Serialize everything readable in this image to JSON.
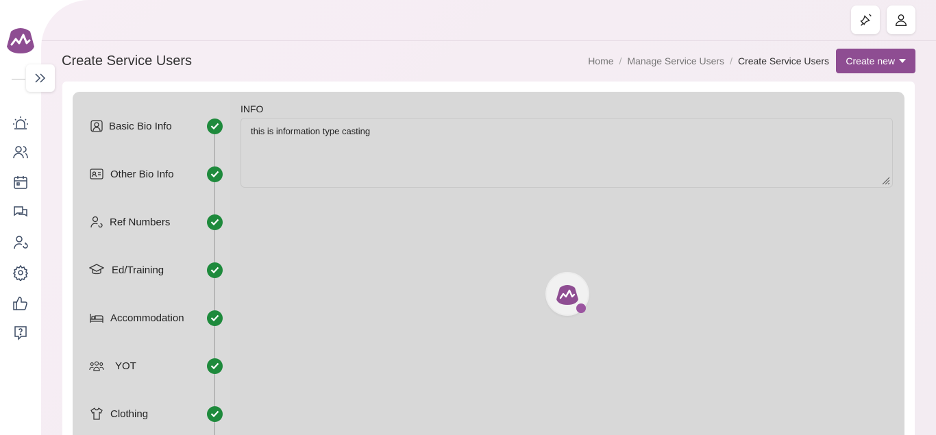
{
  "header": {
    "page_title": "Create Service Users",
    "breadcrumb": [
      "Home",
      "Manage Service Users",
      "Create Service Users"
    ],
    "create_button": "Create new",
    "top_icons": [
      "notification-icon",
      "user-icon"
    ]
  },
  "rail": {
    "icons": [
      "alarm-icon",
      "people-icon",
      "calendar-icon",
      "chat-icon",
      "user-refresh-icon",
      "gear-icon",
      "thumbs-up-icon",
      "help-icon"
    ]
  },
  "steps": [
    {
      "label": "Basic Bio Info",
      "icon": "user-square-icon",
      "done": true
    },
    {
      "label": "Other Bio Info",
      "icon": "id-card-icon",
      "done": true
    },
    {
      "label": "Ref Numbers",
      "icon": "user-ref-icon",
      "done": true
    },
    {
      "label": "Ed/Training",
      "icon": "graduation-cap-icon",
      "done": true
    },
    {
      "label": "Accommodation",
      "icon": "bed-icon",
      "done": true
    },
    {
      "label": "YOT",
      "icon": "group-icon",
      "done": true
    },
    {
      "label": "Clothing",
      "icon": "shirt-icon",
      "done": true
    }
  ],
  "info": {
    "label": "INFO",
    "value": "this is information type casting"
  },
  "colors": {
    "accent": "#8e4d92",
    "check": "#1e8a3c"
  }
}
